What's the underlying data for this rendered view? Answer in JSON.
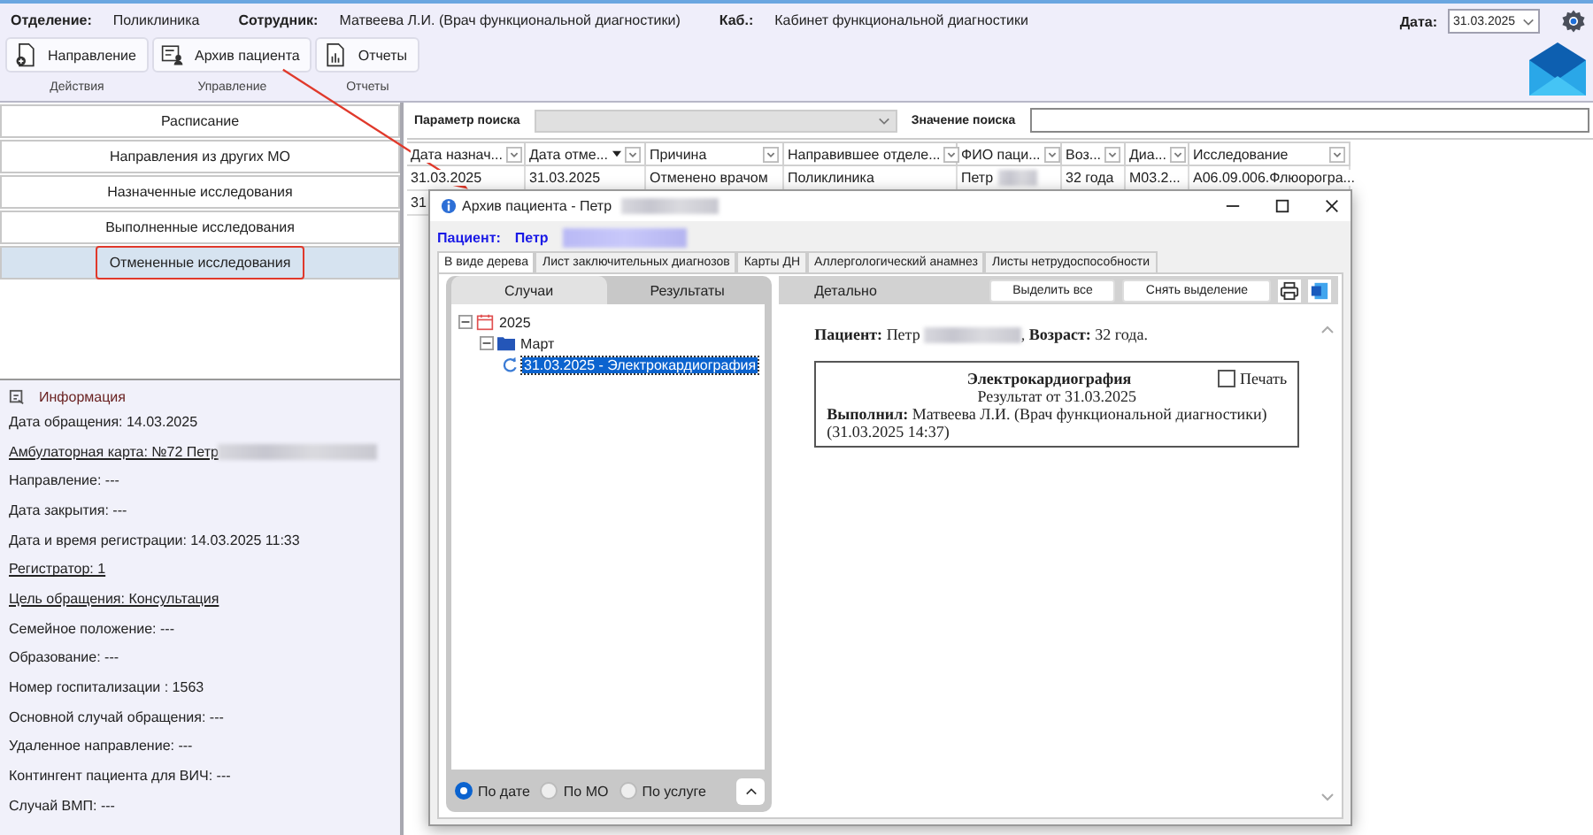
{
  "header": {
    "fields": [
      {
        "label": "Отделение:",
        "value": "Поликлиника"
      },
      {
        "label": "Сотрудник:",
        "value": "Матвеева Л.И. (Врач функциональной диагностики)"
      },
      {
        "label": "Каб.:",
        "value": "Кабинет функциональной диагностики"
      }
    ],
    "date": {
      "label": "Дата:",
      "value": "31.03.2025"
    }
  },
  "toolbar": [
    {
      "button": "Направление",
      "kind": "document",
      "group": "Действия"
    },
    {
      "button": "Архив пациента",
      "kind": "archive",
      "group": "Управление"
    },
    {
      "button": "Отчеты",
      "kind": "report",
      "group": "Отчеты"
    }
  ],
  "menu": [
    {
      "label": "Расписание",
      "selected": false,
      "highlighted": false
    },
    {
      "label": "Направления из других МО",
      "selected": false,
      "highlighted": false
    },
    {
      "label": "Назначенные исследования",
      "selected": false,
      "highlighted": false
    },
    {
      "label": "Выполненные исследования",
      "selected": false,
      "highlighted": false
    },
    {
      "label": "Отмененные исследования",
      "selected": true,
      "highlighted": true
    }
  ],
  "info": {
    "title": "Информация",
    "lines": [
      {
        "text": "Дата обращения: 14.03.2025",
        "link": false,
        "redacted": false
      },
      {
        "text": "Амбулаторная карта: №72 Петр",
        "link": true,
        "redacted": true
      },
      {
        "text": "Направление: ---",
        "link": false,
        "redacted": false
      },
      {
        "text": "Дата закрытия: ---",
        "link": false,
        "redacted": false
      },
      {
        "text": "Дата и время регистрации: 14.03.2025 11:33",
        "link": false,
        "redacted": false
      },
      {
        "text": "Регистратор: 1",
        "link": true,
        "redacted": false
      },
      {
        "text": "Цель обращения: Консультация",
        "link": true,
        "redacted": false
      },
      {
        "text": "Семейное положение: ---",
        "link": false,
        "redacted": false
      },
      {
        "text": "Образование: ---",
        "link": false,
        "redacted": false
      },
      {
        "text": "Номер госпитализации : 1563",
        "link": false,
        "redacted": false
      },
      {
        "text": "Основной случай обращения: ---",
        "link": false,
        "redacted": false
      },
      {
        "text": "Удаленное направление: ---",
        "link": false,
        "redacted": false
      },
      {
        "text": "Контингент пациента для ВИЧ: ---",
        "link": false,
        "redacted": false
      },
      {
        "text": "Случай ВМП: ---",
        "link": false,
        "redacted": false
      }
    ]
  },
  "search": {
    "param_label": "Параметр поиска",
    "value_label": "Значение поиска"
  },
  "table": {
    "columns": [
      {
        "label": "Дата назнач...",
        "sorted": false
      },
      {
        "label": "Дата отме...",
        "sorted": true
      },
      {
        "label": "Причина",
        "sorted": false
      },
      {
        "label": "Направившее отделе...",
        "sorted": false
      },
      {
        "label": "ФИО паци...",
        "sorted": false
      },
      {
        "label": "Воз...",
        "sorted": false
      },
      {
        "label": "Диа...",
        "sorted": false
      },
      {
        "label": "Исследование",
        "sorted": false
      }
    ],
    "rows": [
      [
        "31.03.2025",
        "31.03.2025",
        "Отменено врачом",
        "Поликлиника",
        "Петр",
        "32 года",
        "М03.2...",
        "А06.09.006.Флюорогра..."
      ],
      [
        "31"
      ]
    ]
  },
  "dialog": {
    "title": "Архив пациента - Петр",
    "patient_label": "Пациент:",
    "patient_name": "Петр",
    "tabs": [
      {
        "label": "В виде дерева",
        "selected": true
      },
      {
        "label": "Лист заключительных диагнозов",
        "selected": false
      },
      {
        "label": "Карты ДН",
        "selected": false
      },
      {
        "label": "Аллергологический анамнез",
        "selected": false
      },
      {
        "label": "Листы нетрудоспособности",
        "selected": false
      }
    ],
    "left_tabs": [
      {
        "label": "Случаи",
        "selected": false
      },
      {
        "label": "Результаты",
        "selected": true
      }
    ],
    "tree": [
      {
        "label": "2025",
        "kind": "year",
        "expanded": true,
        "children": [
          {
            "label": "Март",
            "kind": "folder",
            "expanded": true,
            "children": [
              {
                "label": "31.03.2025 - Электрокардиография",
                "kind": "result",
                "selected": true
              }
            ]
          }
        ]
      }
    ],
    "filters": [
      {
        "label": "По дате",
        "selected": true
      },
      {
        "label": "По МО",
        "selected": false
      },
      {
        "label": "По услуге",
        "selected": false
      }
    ],
    "detail": {
      "title": "Детально",
      "buttons": [
        "Выделить все",
        "Снять выделение"
      ],
      "patient": "**Пациент:** Петр",
      "age": ", **Возраст:** 32 года.",
      "result": {
        "title": "Электрокардиография",
        "print_label": "Печать",
        "print_checked": false,
        "date_line": "Результат от 31.03.2025",
        "performer": "**Выполнил:** Матвеева Л.И. (Врач функциональной диагностики) (31.03.2025 14:37)"
      }
    }
  }
}
